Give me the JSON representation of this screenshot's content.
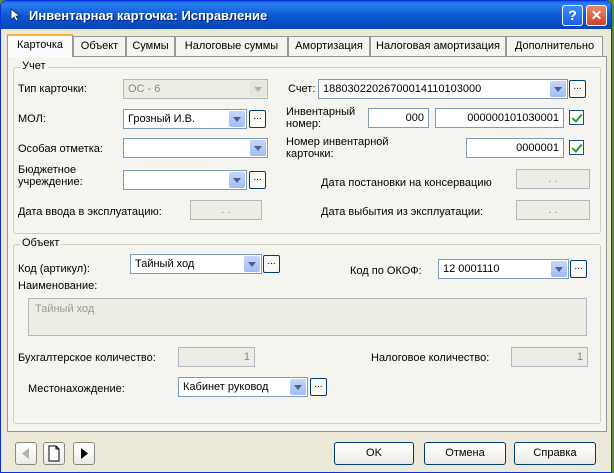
{
  "window": {
    "title": "Инвентарная карточка: Исправление",
    "help": "?",
    "close": "✕"
  },
  "tabs": [
    {
      "label": "Карточка",
      "active": true
    },
    {
      "label": "Объект"
    },
    {
      "label": "Суммы"
    },
    {
      "label": "Налоговые суммы"
    },
    {
      "label": "Амортизация"
    },
    {
      "label": "Налоговая амортизация"
    },
    {
      "label": "Дополнительно"
    }
  ],
  "uchet": {
    "legend": "Учет",
    "tip_label": "Тип карточки:",
    "tip_value": "ОС - 6",
    "schet_label": "Счет:",
    "schet_value": "18803022026700014110103000",
    "mol_label": "МОЛ:",
    "mol_value": "Грозный И.В.",
    "inv_label": "Инвентарный номер:",
    "inv_prefix": "000",
    "inv_number": "000000101030001",
    "osobaya_label": "Особая отметка:",
    "osobaya_value": "",
    "nomer_label": "Номер инвентарной карточки:",
    "nomer_value": "0000001",
    "budget_label": "Бюджетное учреждение:",
    "budget_value": "",
    "kons_label": "Дата постановки на консервацию",
    "kons_value": ". .",
    "vvod_label": "Дата ввода в эксплуатацию:",
    "vvod_value": ". .",
    "vybytie_label": "Дата выбытия из эксплуатации:",
    "vybytie_value": ". ."
  },
  "obekt": {
    "legend": "Объект",
    "kod_label": "Код (артикул):",
    "kod_value": "Тайный ход",
    "okof_label": "Код по ОКОФ:",
    "okof_value": "12 0001110",
    "name_label": "Наименование:",
    "name_value": "Тайный ход",
    "buh_label": "Бухгалтерское количество:",
    "buh_value": "1",
    "nal_label": "Налоговое количество:",
    "nal_value": "1",
    "mesto_label": "Местонахождение:",
    "mesto_value": "Кабинет руковод"
  },
  "buttons": {
    "ok": "OK",
    "cancel": "Отмена",
    "help": "Справка",
    "ellipsis": "..."
  }
}
